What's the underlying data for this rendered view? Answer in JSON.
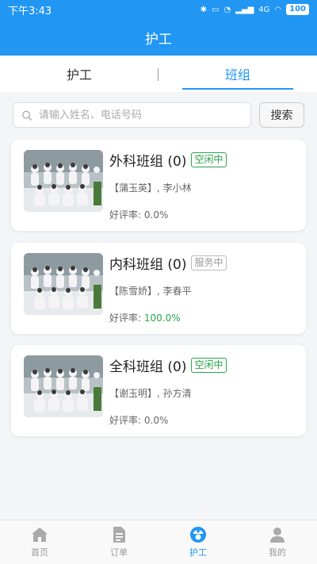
{
  "status_bar": {
    "time": "下午3:43",
    "network": "4G",
    "battery": "100"
  },
  "app_bar": {
    "title": "护工"
  },
  "tabs": [
    {
      "label": "护工"
    },
    {
      "label": "班组"
    }
  ],
  "search": {
    "placeholder": "请输入姓名、电话号码",
    "button_label": "搜索"
  },
  "teams": [
    {
      "name": "外科班组 (0)",
      "status": "空闲中",
      "members": "【蒲玉英】, 李小林",
      "rating_label": "好评率:",
      "rating_value": "0.0%"
    },
    {
      "name": "内科班组 (0)",
      "status": "服务中",
      "members": "【陈雪娇】, 李春平",
      "rating_label": "好评率:",
      "rating_value": "100.0%"
    },
    {
      "name": "全科班组 (0)",
      "status": "空闲中",
      "members": "【谢玉明】, 孙方清",
      "rating_label": "好评率:",
      "rating_value": "0.0%"
    }
  ],
  "bottom_nav": [
    {
      "label": "首页",
      "icon": "home-icon"
    },
    {
      "label": "订单",
      "icon": "order-icon"
    },
    {
      "label": "护工",
      "icon": "nurse-icon"
    },
    {
      "label": "我的",
      "icon": "user-icon"
    }
  ],
  "colors": {
    "primary": "#2196f3",
    "idle_green": "#2ba34a",
    "busy_gray": "#999999"
  }
}
